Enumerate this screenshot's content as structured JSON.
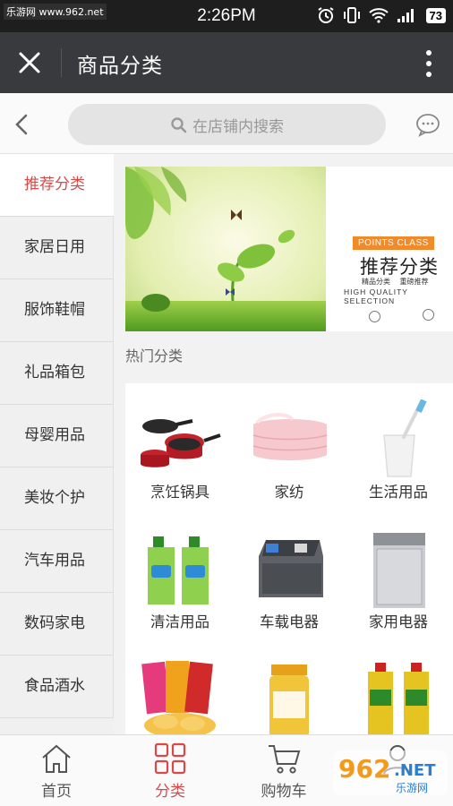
{
  "status_bar": {
    "watermark": "乐游网 www.962.net",
    "time": "2:26PM",
    "battery": "73"
  },
  "title_bar": {
    "title": "商品分类"
  },
  "search": {
    "placeholder": "在店铺内搜索"
  },
  "sidebar": {
    "items": [
      {
        "label": "推荐分类",
        "active": true
      },
      {
        "label": "家居日用"
      },
      {
        "label": "服饰鞋帽"
      },
      {
        "label": "礼品箱包"
      },
      {
        "label": "母婴用品"
      },
      {
        "label": "美妆个护"
      },
      {
        "label": "汽车用品"
      },
      {
        "label": "数码家电"
      },
      {
        "label": "食品酒水"
      }
    ]
  },
  "banner": {
    "tag": "POINTS CLASS",
    "title": "推荐分类",
    "subtitle": "精品分类  　重磅推荐",
    "english": "HIGH QUALITY SELECTION"
  },
  "section": {
    "title": "热门分类"
  },
  "categories": [
    {
      "label": "烹饪锅具",
      "icon": "cookware-icon"
    },
    {
      "label": "家纺",
      "icon": "bedding-icon"
    },
    {
      "label": "生活用品",
      "icon": "toothbrush-cup-icon"
    },
    {
      "label": "清洁用品",
      "icon": "detergent-icon"
    },
    {
      "label": "车载电器",
      "icon": "car-fridge-icon"
    },
    {
      "label": "家用电器",
      "icon": "dishwasher-icon"
    },
    {
      "label": "",
      "icon": "snacks-icon"
    },
    {
      "label": "",
      "icon": "honey-jar-icon"
    },
    {
      "label": "",
      "icon": "cooking-oil-icon"
    }
  ],
  "tabs": [
    {
      "label": "首页",
      "icon": "home-icon"
    },
    {
      "label": "分类",
      "icon": "category-grid-icon",
      "active": true
    },
    {
      "label": "购物车",
      "icon": "cart-icon"
    },
    {
      "label": "",
      "icon": "user-icon"
    }
  ],
  "watermark_logo": {
    "brand": "962.NET",
    "text": "乐游网"
  },
  "colors": {
    "accent": "#d84a4a",
    "title_bar": "#383a3d",
    "banner_tag": "#f08a2b"
  }
}
